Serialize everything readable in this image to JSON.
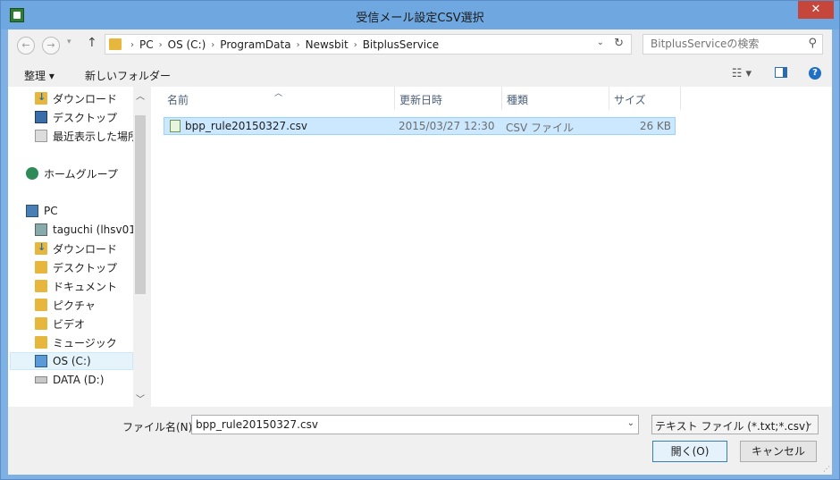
{
  "window": {
    "title": "受信メール設定CSV選択",
    "close_label": "✕"
  },
  "address": {
    "crumbs": [
      "PC",
      "OS (C:)",
      "ProgramData",
      "Newsbit",
      "BitplusService"
    ],
    "search_placeholder": "BitplusServiceの検索"
  },
  "toolbar": {
    "organize_label": "整理 ▾",
    "new_folder_label": "新しいフォルダー"
  },
  "nav": {
    "items": [
      "ダウンロード",
      "デスクトップ",
      "最近表示した場所",
      "ホームグループ",
      "PC",
      "taguchi (lhsv01",
      "ダウンロード",
      "デスクトップ",
      "ドキュメント",
      "ピクチャ",
      "ビデオ",
      "ミュージック",
      "OS (C:)",
      "DATA (D:)"
    ]
  },
  "columns": [
    "名前",
    "更新日時",
    "種類",
    "サイズ"
  ],
  "files": [
    {
      "name": "bpp_rule20150327.csv",
      "date": "2015/03/27 12:30",
      "type": "CSV ファイル",
      "size": "26 KB"
    }
  ],
  "bottom": {
    "filename_label": "ファイル名(N):",
    "filename_value": "bpp_rule20150327.csv",
    "filetype_value": "テキスト ファイル (*.txt;*.csv)",
    "open_label": "開く(O)",
    "cancel_label": "キャンセル"
  }
}
